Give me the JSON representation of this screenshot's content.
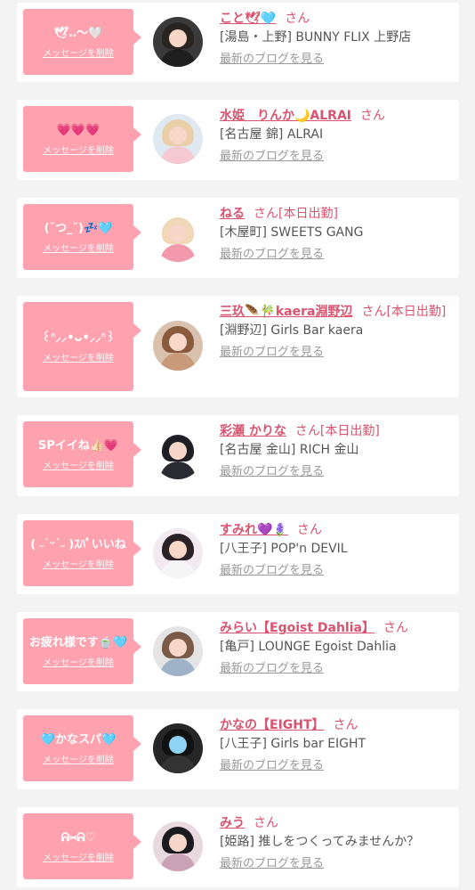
{
  "delete_label": "メッセージを削除",
  "san_label": "さん",
  "blog_label": "最新のブログを見る",
  "colors": {
    "accent": "#d9536f",
    "bubble": "#ffa2b0",
    "background": "#f3f3f3"
  },
  "items": [
    {
      "message": "🕊‥〜🤍",
      "name": "こと🕊🩵",
      "status": "",
      "area": "[湯島・上野]",
      "shop": "BUNNY FLIX 上野店"
    },
    {
      "message": "💗💗💗",
      "name": "水姫　りんか🌙ALRAI",
      "status": "",
      "area": "[名古屋 錦]",
      "shop": "ALRAI"
    },
    {
      "message": "(˘つ_˘)💤🩵",
      "name": "ねる",
      "status": "[本日出勤]",
      "area": "[木屋町]",
      "shop": "SWEETS GANG"
    },
    {
      "message": "꒰ᐢ⸝⸝•ᴗ•⸝⸝ᐢ꒱",
      "name": "三玖🪶🎋kaera淵野辺",
      "status": "[本日出勤]",
      "area": "[淵野辺]",
      "shop": "Girls Bar kaera"
    },
    {
      "message": "SPイイね👍🏻💗",
      "name": "彩瀬 かりな",
      "status": "[本日出勤]",
      "area": "[名古屋 金山]",
      "shop": "RICH 金山"
    },
    {
      "message": "( ˶˙ᵕ˙˶ )ｽﾊﾟいいね",
      "name": "すみれ💜🪻",
      "status": "",
      "area": "[八王子]",
      "shop": "POP'n DEVIL"
    },
    {
      "message": "お疲れ様です🍵🩵",
      "name": "みらい【Egoist Dahlia】",
      "status": "",
      "area": "[亀戸]",
      "shop": "LOUNGE Egoist Dahlia"
    },
    {
      "message": "🩵かなスパ🩵",
      "name": "かなの【EIGHT】",
      "status": "",
      "area": "[八王子]",
      "shop": "Girls bar EIGHT"
    },
    {
      "message": "ᕱ⑅ᕱ♡",
      "name": "みう",
      "status": "",
      "area": "[姫路]",
      "shop": "推しをつくってみませんか？"
    }
  ]
}
